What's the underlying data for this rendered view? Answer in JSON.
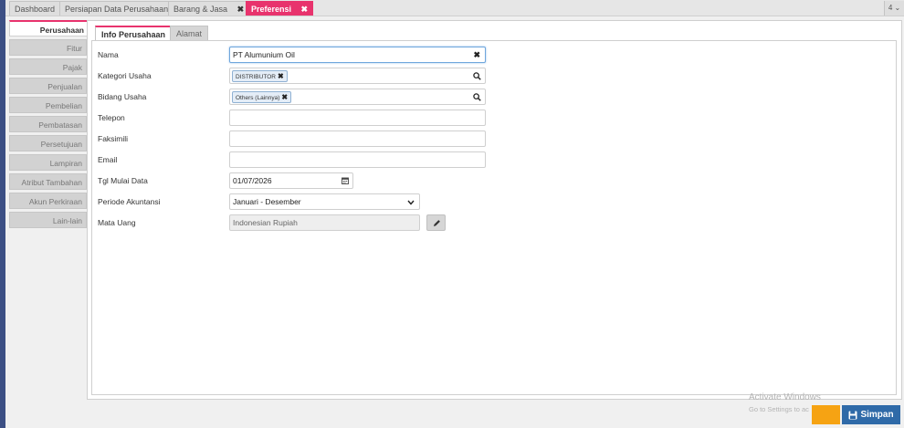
{
  "top_tabs": [
    {
      "label": "Dashboard"
    },
    {
      "label": "Persiapan Data Perusahaan"
    },
    {
      "label": "Barang & Jasa",
      "closable": true
    },
    {
      "label": "Preferensi",
      "closable": true,
      "active": true
    }
  ],
  "tab_count": "4 ⌄",
  "side_nav": [
    {
      "label": "Perusahaan",
      "active": true
    },
    {
      "label": "Fitur"
    },
    {
      "label": "Pajak"
    },
    {
      "label": "Penjualan"
    },
    {
      "label": "Pembelian"
    },
    {
      "label": "Pembatasan"
    },
    {
      "label": "Persetujuan"
    },
    {
      "label": "Lampiran"
    },
    {
      "label": "Atribut Tambahan"
    },
    {
      "label": "Akun Perkiraan"
    },
    {
      "label": "Lain-lain"
    }
  ],
  "inner_tabs": [
    {
      "label": "Info Perusahaan",
      "active": true
    },
    {
      "label": "Alamat"
    }
  ],
  "form": {
    "nama": {
      "label": "Nama",
      "value": "PT Alumunium Oil"
    },
    "kategori_usaha": {
      "label": "Kategori Usaha",
      "chip": "DISTRIBUTOR"
    },
    "bidang_usaha": {
      "label": "Bidang Usaha",
      "chip": "Others (Lainnya)"
    },
    "telepon": {
      "label": "Telepon",
      "value": ""
    },
    "faksimili": {
      "label": "Faksimili",
      "value": ""
    },
    "email": {
      "label": "Email",
      "value": ""
    },
    "tgl_mulai_data": {
      "label": "Tgl Mulai Data",
      "value": "01/07/2026"
    },
    "periode_akuntansi": {
      "label": "Periode Akuntansi",
      "value": "Januari - Desember"
    },
    "mata_uang": {
      "label": "Mata Uang",
      "value": "Indonesian Rupiah"
    }
  },
  "watermark": {
    "line1": "Activate Windows",
    "line2": "Go to Settings to ac"
  },
  "buttons": {
    "save": "Simpan"
  },
  "colors": {
    "accent": "#e8336d",
    "save": "#2f6aa8",
    "orange": "#f6a313",
    "nav_strip": "#3c4f84"
  },
  "icons": {
    "clear": "close-icon",
    "search": "search-icon",
    "calendar": "calendar-icon",
    "dropdown": "chevron-down-icon",
    "edit": "pencil-icon",
    "save": "floppy-disk-icon"
  }
}
